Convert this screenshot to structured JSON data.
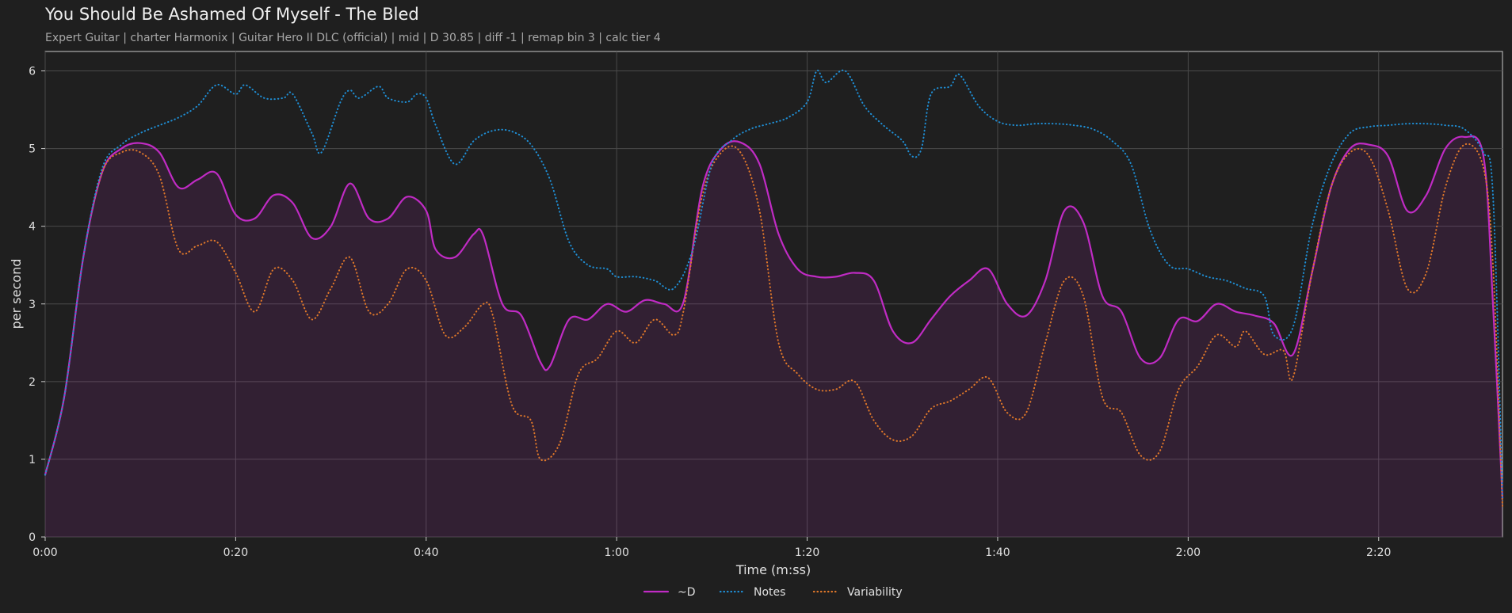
{
  "chart_data": {
    "type": "line",
    "title": "You Should Be Ashamed Of Myself - The Bled",
    "subtitle": "Expert Guitar  |  charter Harmonix  |  Guitar Hero II DLC (official)  |  mid  |  D 30.85  |  diff -1  |  remap bin 3  |  calc tier 4",
    "xlabel": "Time (m:ss)",
    "ylabel": "per second",
    "xlim": [
      0,
      153
    ],
    "ylim": [
      0,
      6.25
    ],
    "x_ticks": [
      0,
      20,
      40,
      60,
      80,
      100,
      120,
      140
    ],
    "x_tick_labels": [
      "0:00",
      "0:20",
      "0:40",
      "1:00",
      "1:20",
      "1:40",
      "2:00",
      "2:20"
    ],
    "y_ticks": [
      0,
      1,
      2,
      3,
      4,
      5,
      6
    ],
    "y_tick_labels": [
      "0",
      "1",
      "2",
      "3",
      "4",
      "5",
      "6"
    ],
    "grid": true,
    "legend_position": "bottom-center",
    "series": [
      {
        "name": "~D",
        "color": "#c02bc4",
        "style": "solid",
        "fill": true,
        "points": [
          [
            0,
            0.8
          ],
          [
            2,
            1.8
          ],
          [
            4,
            3.6
          ],
          [
            6,
            4.7
          ],
          [
            8,
            5.0
          ],
          [
            10,
            5.07
          ],
          [
            12,
            4.95
          ],
          [
            14,
            4.5
          ],
          [
            16,
            4.6
          ],
          [
            18,
            4.68
          ],
          [
            20,
            4.15
          ],
          [
            22,
            4.1
          ],
          [
            24,
            4.4
          ],
          [
            26,
            4.3
          ],
          [
            28,
            3.85
          ],
          [
            30,
            4.0
          ],
          [
            32,
            4.55
          ],
          [
            34,
            4.1
          ],
          [
            36,
            4.1
          ],
          [
            38,
            4.38
          ],
          [
            40,
            4.2
          ],
          [
            41,
            3.7
          ],
          [
            43,
            3.6
          ],
          [
            45,
            3.9
          ],
          [
            46,
            3.88
          ],
          [
            48,
            3.0
          ],
          [
            50,
            2.85
          ],
          [
            52,
            2.25
          ],
          [
            53,
            2.2
          ],
          [
            55,
            2.8
          ],
          [
            57,
            2.8
          ],
          [
            59,
            3.0
          ],
          [
            61,
            2.9
          ],
          [
            63,
            3.05
          ],
          [
            65,
            3.0
          ],
          [
            67,
            3.02
          ],
          [
            69,
            4.5
          ],
          [
            71,
            5.0
          ],
          [
            73,
            5.08
          ],
          [
            75,
            4.8
          ],
          [
            77,
            3.9
          ],
          [
            79,
            3.45
          ],
          [
            81,
            3.35
          ],
          [
            83,
            3.35
          ],
          [
            85,
            3.4
          ],
          [
            87,
            3.3
          ],
          [
            89,
            2.65
          ],
          [
            91,
            2.5
          ],
          [
            93,
            2.8
          ],
          [
            95,
            3.1
          ],
          [
            97,
            3.3
          ],
          [
            99,
            3.45
          ],
          [
            101,
            3.0
          ],
          [
            103,
            2.85
          ],
          [
            105,
            3.3
          ],
          [
            107,
            4.2
          ],
          [
            109,
            4.05
          ],
          [
            111,
            3.1
          ],
          [
            113,
            2.9
          ],
          [
            115,
            2.3
          ],
          [
            117,
            2.3
          ],
          [
            119,
            2.8
          ],
          [
            121,
            2.78
          ],
          [
            123,
            3.0
          ],
          [
            125,
            2.9
          ],
          [
            127,
            2.85
          ],
          [
            129,
            2.75
          ],
          [
            131,
            2.35
          ],
          [
            133,
            3.4
          ],
          [
            135,
            4.5
          ],
          [
            137,
            5.0
          ],
          [
            139,
            5.05
          ],
          [
            141,
            4.9
          ],
          [
            143,
            4.2
          ],
          [
            145,
            4.4
          ],
          [
            147,
            5.0
          ],
          [
            149,
            5.15
          ],
          [
            151,
            4.9
          ],
          [
            152,
            3.0
          ],
          [
            153,
            0.5
          ]
        ]
      },
      {
        "name": "Notes",
        "color": "#1f8fd6",
        "style": "dotted",
        "fill": false,
        "points": [
          [
            0,
            0.8
          ],
          [
            2,
            1.8
          ],
          [
            4,
            3.6
          ],
          [
            6,
            4.75
          ],
          [
            8,
            5.05
          ],
          [
            10,
            5.2
          ],
          [
            12,
            5.3
          ],
          [
            14,
            5.4
          ],
          [
            16,
            5.55
          ],
          [
            18,
            5.82
          ],
          [
            20,
            5.7
          ],
          [
            21,
            5.82
          ],
          [
            23,
            5.65
          ],
          [
            25,
            5.65
          ],
          [
            26,
            5.7
          ],
          [
            28,
            5.2
          ],
          [
            29,
            4.95
          ],
          [
            31,
            5.6
          ],
          [
            32,
            5.75
          ],
          [
            33,
            5.65
          ],
          [
            35,
            5.8
          ],
          [
            36,
            5.65
          ],
          [
            38,
            5.6
          ],
          [
            39,
            5.7
          ],
          [
            40,
            5.65
          ],
          [
            41,
            5.3
          ],
          [
            43,
            4.8
          ],
          [
            45,
            5.1
          ],
          [
            47,
            5.23
          ],
          [
            49,
            5.22
          ],
          [
            51,
            5.05
          ],
          [
            53,
            4.6
          ],
          [
            55,
            3.8
          ],
          [
            57,
            3.5
          ],
          [
            59,
            3.45
          ],
          [
            60,
            3.35
          ],
          [
            62,
            3.35
          ],
          [
            64,
            3.3
          ],
          [
            66,
            3.2
          ],
          [
            68,
            3.7
          ],
          [
            70,
            4.8
          ],
          [
            72,
            5.1
          ],
          [
            74,
            5.25
          ],
          [
            76,
            5.32
          ],
          [
            78,
            5.4
          ],
          [
            80,
            5.6
          ],
          [
            81,
            6.0
          ],
          [
            82,
            5.85
          ],
          [
            84,
            6.0
          ],
          [
            86,
            5.55
          ],
          [
            88,
            5.3
          ],
          [
            90,
            5.1
          ],
          [
            91,
            4.9
          ],
          [
            92,
            5.0
          ],
          [
            93,
            5.7
          ],
          [
            95,
            5.8
          ],
          [
            96,
            5.95
          ],
          [
            98,
            5.55
          ],
          [
            100,
            5.35
          ],
          [
            102,
            5.3
          ],
          [
            104,
            5.32
          ],
          [
            106,
            5.32
          ],
          [
            108,
            5.3
          ],
          [
            110,
            5.25
          ],
          [
            112,
            5.1
          ],
          [
            114,
            4.8
          ],
          [
            116,
            3.95
          ],
          [
            118,
            3.5
          ],
          [
            120,
            3.45
          ],
          [
            122,
            3.35
          ],
          [
            124,
            3.3
          ],
          [
            126,
            3.2
          ],
          [
            128,
            3.1
          ],
          [
            129,
            2.6
          ],
          [
            131,
            2.7
          ],
          [
            133,
            4.0
          ],
          [
            135,
            4.8
          ],
          [
            137,
            5.2
          ],
          [
            139,
            5.28
          ],
          [
            141,
            5.3
          ],
          [
            143,
            5.32
          ],
          [
            145,
            5.32
          ],
          [
            147,
            5.3
          ],
          [
            149,
            5.25
          ],
          [
            151,
            4.95
          ],
          [
            152,
            4.4
          ],
          [
            153,
            0.5
          ]
        ]
      },
      {
        "name": "Variability",
        "color": "#e0782a",
        "style": "dotted",
        "fill": false,
        "points": [
          [
            0,
            0.8
          ],
          [
            2,
            1.8
          ],
          [
            4,
            3.6
          ],
          [
            6,
            4.7
          ],
          [
            8,
            4.95
          ],
          [
            10,
            4.95
          ],
          [
            12,
            4.65
          ],
          [
            14,
            3.7
          ],
          [
            16,
            3.75
          ],
          [
            18,
            3.8
          ],
          [
            20,
            3.4
          ],
          [
            22,
            2.9
          ],
          [
            24,
            3.45
          ],
          [
            26,
            3.3
          ],
          [
            28,
            2.8
          ],
          [
            30,
            3.2
          ],
          [
            32,
            3.6
          ],
          [
            34,
            2.9
          ],
          [
            36,
            3.0
          ],
          [
            38,
            3.45
          ],
          [
            40,
            3.3
          ],
          [
            42,
            2.6
          ],
          [
            44,
            2.7
          ],
          [
            46,
            3.0
          ],
          [
            47,
            2.85
          ],
          [
            49,
            1.7
          ],
          [
            51,
            1.5
          ],
          [
            52,
            1.0
          ],
          [
            54,
            1.2
          ],
          [
            56,
            2.1
          ],
          [
            58,
            2.3
          ],
          [
            60,
            2.65
          ],
          [
            62,
            2.5
          ],
          [
            64,
            2.8
          ],
          [
            66,
            2.6
          ],
          [
            67,
            2.9
          ],
          [
            69,
            4.4
          ],
          [
            71,
            4.95
          ],
          [
            73,
            4.95
          ],
          [
            75,
            4.2
          ],
          [
            77,
            2.5
          ],
          [
            79,
            2.1
          ],
          [
            81,
            1.9
          ],
          [
            83,
            1.9
          ],
          [
            85,
            2.0
          ],
          [
            87,
            1.5
          ],
          [
            89,
            1.25
          ],
          [
            91,
            1.3
          ],
          [
            93,
            1.65
          ],
          [
            95,
            1.75
          ],
          [
            97,
            1.9
          ],
          [
            99,
            2.05
          ],
          [
            101,
            1.6
          ],
          [
            103,
            1.6
          ],
          [
            105,
            2.5
          ],
          [
            107,
            3.3
          ],
          [
            109,
            3.1
          ],
          [
            111,
            1.8
          ],
          [
            113,
            1.6
          ],
          [
            115,
            1.05
          ],
          [
            117,
            1.1
          ],
          [
            119,
            1.9
          ],
          [
            121,
            2.2
          ],
          [
            123,
            2.6
          ],
          [
            125,
            2.45
          ],
          [
            126,
            2.65
          ],
          [
            128,
            2.35
          ],
          [
            130,
            2.4
          ],
          [
            131,
            2.05
          ],
          [
            133,
            3.4
          ],
          [
            135,
            4.5
          ],
          [
            137,
            4.95
          ],
          [
            139,
            4.9
          ],
          [
            141,
            4.2
          ],
          [
            143,
            3.2
          ],
          [
            145,
            3.4
          ],
          [
            147,
            4.5
          ],
          [
            149,
            5.05
          ],
          [
            151,
            4.75
          ],
          [
            152,
            3.5
          ],
          [
            153,
            0.4
          ]
        ]
      }
    ]
  }
}
